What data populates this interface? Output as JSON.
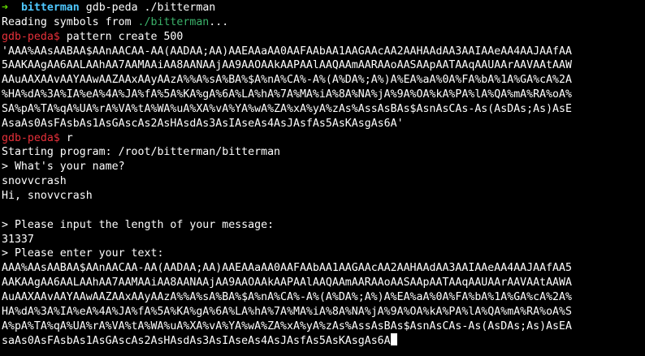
{
  "colors": {
    "background": "#000000",
    "foreground": "#ffffff",
    "shell_arrow": "#5fd700",
    "shell_dir": "#4fc8ff",
    "gdb_prompt": "#e8303a",
    "path_text": "#3bb26a"
  },
  "shell": {
    "arrow": "➜",
    "dir": "bitterman",
    "command": "gdb-peda ./bitterman"
  },
  "reading": {
    "text": "Reading symbols from ",
    "path": "./bitterman",
    "suffix": "..."
  },
  "gdb": {
    "prompt": "gdb-peda$",
    "cmd1": "pattern create 500",
    "cmd2": "r"
  },
  "pattern_lines": [
    "'AAA%AAsAABAA$AAnAACAA-AA(AADAA;AA)AAEAAaAA0AAFAAbAA1AAGAAcAA2AAHAAdAA3AAIAAeAA4AAJAAfAA",
    "5AAKAAgAA6AALAAhAA7AAMAAiAA8AANAAjAA9AAOAAkAAPAAlAAQAAmAARAAoAASAApAATAAqAAUAArAAVAAtAAW",
    "AAuAAXAAvAAYAAwAAZAAxAAyAAzA%%A%sA%BA%$A%nA%CA%-A%(A%DA%;A%)A%EA%aA%0A%FA%bA%1A%GA%cA%2A",
    "%HA%dA%3A%IA%eA%4A%JA%fA%5A%KA%gA%6A%LA%hA%7A%MA%iA%8A%NA%jA%9A%OA%kA%PA%lA%QA%mA%RA%oA%",
    "SA%pA%TA%qA%UA%rA%VA%tA%WA%uA%XA%vA%YA%wA%ZA%xA%yA%zAs%AssAsBAs$AsnAsCAs-As(AsDAs;As)AsE",
    "AsaAs0AsFAsbAs1AsGAscAs2AsHAsdAs3AsIAseAs4AsJAsfAs5AsKAsgAs6A'"
  ],
  "program": {
    "starting": "Starting program: /root/bitterman/bitterman",
    "name_prompt": "> What's your name?",
    "name_input": "snovvcrash",
    "greeting": "Hi, snovvcrash",
    "length_prompt": "> Please input the length of your message:",
    "length_input": "31337",
    "text_prompt": "> Please enter your text:"
  },
  "text_input_lines": [
    "AAA%AAsAABAA$AAnAACAA-AA(AADAA;AA)AAEAAaAA0AAFAAbAA1AAGAAcAA2AAHAAdAA3AAIAAeAA4AAJAAfAA5",
    "AAKAAgAA6AALAAhAA7AAMAAiAA8AANAAjAA9AAOAAkAAPAAlAAQAAmAARAAoAASAApAATAAqAAUAArAAVAAtAAWA",
    "AuAAXAAvAAYAAwAAZAAxAAyAAzA%%A%sA%BA%$A%nA%CA%-A%(A%DA%;A%)A%EA%aA%0A%FA%bA%1A%GA%cA%2A%",
    "HA%dA%3A%IA%eA%4A%JA%fA%5A%KA%gA%6A%LA%hA%7A%MA%iA%8A%NA%jA%9A%OA%kA%PA%lA%QA%mA%RA%oA%S",
    "A%pA%TA%qA%UA%rA%VA%tA%WA%uA%XA%vA%YA%wA%ZA%xA%yA%zAs%AssAsBAs$AsnAsCAs-As(AsDAs;As)AsEA",
    "saAs0AsFAsbAs1AsGAscAs2AsHAsdAs3AsIAseAs4AsJAsfAs5AsKAsgAs6A"
  ]
}
